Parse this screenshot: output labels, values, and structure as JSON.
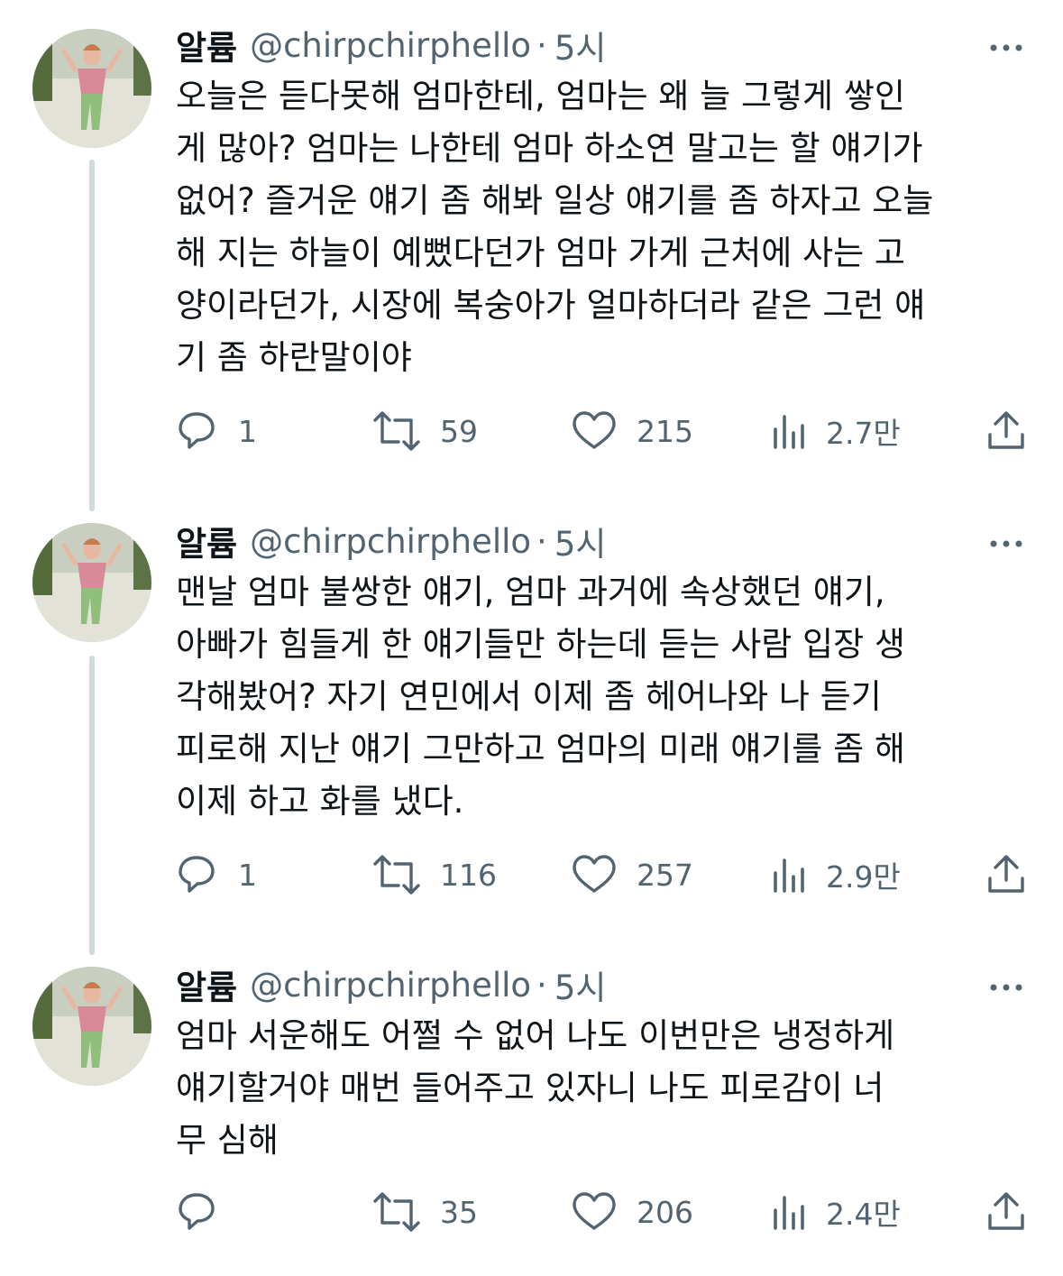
{
  "tweets": [
    {
      "author_name": "알륨",
      "handle": "@chirpchirphello",
      "separator": "·",
      "time": "5시",
      "lines": [
        "오늘은 듣다못해 엄마한테, 엄마는 왜 늘 그렇게 쌓인",
        "게 많아? 엄마는 나한테 엄마 하소연 말고는 할 얘기가",
        "없어? 즐거운 얘기 좀 해봐 일상 얘기를 좀 하자고 오늘",
        "해 지는 하늘이 예뻤다던가 엄마 가게 근처에 사는 고",
        "양이라던가, 시장에 복숭아가 얼마하더라 같은 그런 얘",
        "기 좀 하란말이야"
      ],
      "replies": "1",
      "retweets": "59",
      "likes": "215",
      "views": "2.7만"
    },
    {
      "author_name": "알륨",
      "handle": "@chirpchirphello",
      "separator": "·",
      "time": "5시",
      "lines": [
        "맨날 엄마 불쌍한 얘기, 엄마 과거에 속상했던 얘기,",
        "아빠가 힘들게 한 얘기들만 하는데 듣는 사람 입장 생",
        "각해봤어? 자기 연민에서 이제 좀 헤어나와 나 듣기",
        "피로해 지난 얘기 그만하고 엄마의 미래 얘기를 좀 해",
        "이제 하고 화를 냈다."
      ],
      "replies": "1",
      "retweets": "116",
      "likes": "257",
      "views": "2.9만"
    },
    {
      "author_name": "알륨",
      "handle": "@chirpchirphello",
      "separator": "·",
      "time": "5시",
      "lines": [
        "엄마 서운해도 어쩔 수 없어 나도 이번만은 냉정하게",
        "얘기할거야 매번 들어주고 있자니 나도 피로감이 너",
        "무 심해"
      ],
      "replies": "",
      "retweets": "35",
      "likes": "206",
      "views": "2.4만"
    }
  ],
  "icons": {
    "reply": "reply-icon",
    "retweet": "retweet-icon",
    "like": "heart-icon",
    "views": "views-icon",
    "share": "share-icon",
    "more": "more-icon"
  },
  "colors": {
    "text": "#0f1419",
    "secondary": "#536471",
    "thread_line": "#cfd9de"
  }
}
